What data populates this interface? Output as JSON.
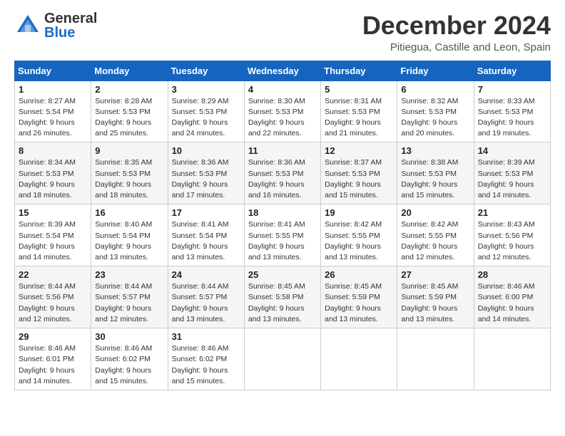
{
  "header": {
    "logo_general": "General",
    "logo_blue": "Blue",
    "month_title": "December 2024",
    "location": "Pitiegua, Castille and Leon, Spain"
  },
  "days_of_week": [
    "Sunday",
    "Monday",
    "Tuesday",
    "Wednesday",
    "Thursday",
    "Friday",
    "Saturday"
  ],
  "weeks": [
    [
      {
        "day": "1",
        "sunrise": "Sunrise: 8:27 AM",
        "sunset": "Sunset: 5:54 PM",
        "daylight": "Daylight: 9 hours and 26 minutes."
      },
      {
        "day": "2",
        "sunrise": "Sunrise: 8:28 AM",
        "sunset": "Sunset: 5:53 PM",
        "daylight": "Daylight: 9 hours and 25 minutes."
      },
      {
        "day": "3",
        "sunrise": "Sunrise: 8:29 AM",
        "sunset": "Sunset: 5:53 PM",
        "daylight": "Daylight: 9 hours and 24 minutes."
      },
      {
        "day": "4",
        "sunrise": "Sunrise: 8:30 AM",
        "sunset": "Sunset: 5:53 PM",
        "daylight": "Daylight: 9 hours and 22 minutes."
      },
      {
        "day": "5",
        "sunrise": "Sunrise: 8:31 AM",
        "sunset": "Sunset: 5:53 PM",
        "daylight": "Daylight: 9 hours and 21 minutes."
      },
      {
        "day": "6",
        "sunrise": "Sunrise: 8:32 AM",
        "sunset": "Sunset: 5:53 PM",
        "daylight": "Daylight: 9 hours and 20 minutes."
      },
      {
        "day": "7",
        "sunrise": "Sunrise: 8:33 AM",
        "sunset": "Sunset: 5:53 PM",
        "daylight": "Daylight: 9 hours and 19 minutes."
      }
    ],
    [
      {
        "day": "8",
        "sunrise": "Sunrise: 8:34 AM",
        "sunset": "Sunset: 5:53 PM",
        "daylight": "Daylight: 9 hours and 18 minutes."
      },
      {
        "day": "9",
        "sunrise": "Sunrise: 8:35 AM",
        "sunset": "Sunset: 5:53 PM",
        "daylight": "Daylight: 9 hours and 18 minutes."
      },
      {
        "day": "10",
        "sunrise": "Sunrise: 8:36 AM",
        "sunset": "Sunset: 5:53 PM",
        "daylight": "Daylight: 9 hours and 17 minutes."
      },
      {
        "day": "11",
        "sunrise": "Sunrise: 8:36 AM",
        "sunset": "Sunset: 5:53 PM",
        "daylight": "Daylight: 9 hours and 16 minutes."
      },
      {
        "day": "12",
        "sunrise": "Sunrise: 8:37 AM",
        "sunset": "Sunset: 5:53 PM",
        "daylight": "Daylight: 9 hours and 15 minutes."
      },
      {
        "day": "13",
        "sunrise": "Sunrise: 8:38 AM",
        "sunset": "Sunset: 5:53 PM",
        "daylight": "Daylight: 9 hours and 15 minutes."
      },
      {
        "day": "14",
        "sunrise": "Sunrise: 8:39 AM",
        "sunset": "Sunset: 5:53 PM",
        "daylight": "Daylight: 9 hours and 14 minutes."
      }
    ],
    [
      {
        "day": "15",
        "sunrise": "Sunrise: 8:39 AM",
        "sunset": "Sunset: 5:54 PM",
        "daylight": "Daylight: 9 hours and 14 minutes."
      },
      {
        "day": "16",
        "sunrise": "Sunrise: 8:40 AM",
        "sunset": "Sunset: 5:54 PM",
        "daylight": "Daylight: 9 hours and 13 minutes."
      },
      {
        "day": "17",
        "sunrise": "Sunrise: 8:41 AM",
        "sunset": "Sunset: 5:54 PM",
        "daylight": "Daylight: 9 hours and 13 minutes."
      },
      {
        "day": "18",
        "sunrise": "Sunrise: 8:41 AM",
        "sunset": "Sunset: 5:55 PM",
        "daylight": "Daylight: 9 hours and 13 minutes."
      },
      {
        "day": "19",
        "sunrise": "Sunrise: 8:42 AM",
        "sunset": "Sunset: 5:55 PM",
        "daylight": "Daylight: 9 hours and 13 minutes."
      },
      {
        "day": "20",
        "sunrise": "Sunrise: 8:42 AM",
        "sunset": "Sunset: 5:55 PM",
        "daylight": "Daylight: 9 hours and 12 minutes."
      },
      {
        "day": "21",
        "sunrise": "Sunrise: 8:43 AM",
        "sunset": "Sunset: 5:56 PM",
        "daylight": "Daylight: 9 hours and 12 minutes."
      }
    ],
    [
      {
        "day": "22",
        "sunrise": "Sunrise: 8:44 AM",
        "sunset": "Sunset: 5:56 PM",
        "daylight": "Daylight: 9 hours and 12 minutes."
      },
      {
        "day": "23",
        "sunrise": "Sunrise: 8:44 AM",
        "sunset": "Sunset: 5:57 PM",
        "daylight": "Daylight: 9 hours and 12 minutes."
      },
      {
        "day": "24",
        "sunrise": "Sunrise: 8:44 AM",
        "sunset": "Sunset: 5:57 PM",
        "daylight": "Daylight: 9 hours and 13 minutes."
      },
      {
        "day": "25",
        "sunrise": "Sunrise: 8:45 AM",
        "sunset": "Sunset: 5:58 PM",
        "daylight": "Daylight: 9 hours and 13 minutes."
      },
      {
        "day": "26",
        "sunrise": "Sunrise: 8:45 AM",
        "sunset": "Sunset: 5:59 PM",
        "daylight": "Daylight: 9 hours and 13 minutes."
      },
      {
        "day": "27",
        "sunrise": "Sunrise: 8:45 AM",
        "sunset": "Sunset: 5:59 PM",
        "daylight": "Daylight: 9 hours and 13 minutes."
      },
      {
        "day": "28",
        "sunrise": "Sunrise: 8:46 AM",
        "sunset": "Sunset: 6:00 PM",
        "daylight": "Daylight: 9 hours and 14 minutes."
      }
    ],
    [
      {
        "day": "29",
        "sunrise": "Sunrise: 8:46 AM",
        "sunset": "Sunset: 6:01 PM",
        "daylight": "Daylight: 9 hours and 14 minutes."
      },
      {
        "day": "30",
        "sunrise": "Sunrise: 8:46 AM",
        "sunset": "Sunset: 6:02 PM",
        "daylight": "Daylight: 9 hours and 15 minutes."
      },
      {
        "day": "31",
        "sunrise": "Sunrise: 8:46 AM",
        "sunset": "Sunset: 6:02 PM",
        "daylight": "Daylight: 9 hours and 15 minutes."
      },
      null,
      null,
      null,
      null
    ]
  ]
}
